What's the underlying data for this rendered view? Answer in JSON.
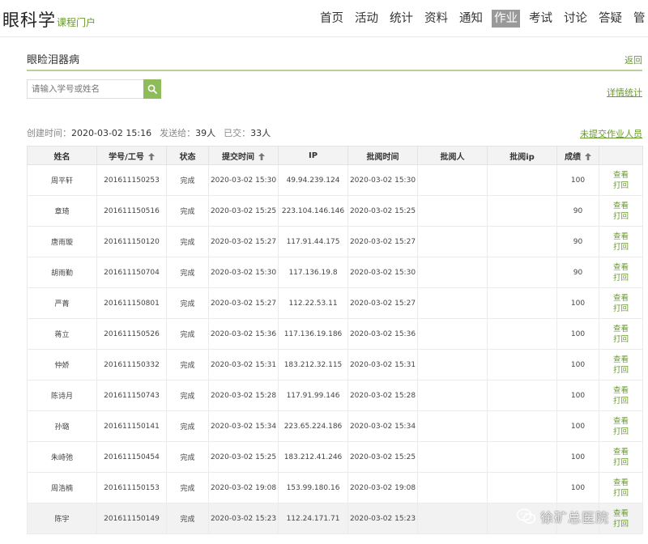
{
  "header": {
    "brand": "眼科学",
    "brand_sub": "课程门户",
    "nav": [
      "首页",
      "活动",
      "统计",
      "资料",
      "通知",
      "作业",
      "考试",
      "讨论",
      "答疑",
      "管"
    ],
    "active_nav": "作业"
  },
  "subheader": {
    "title": "眼睑泪器病",
    "back": "返回"
  },
  "search": {
    "placeholder": "请输入学号或姓名",
    "icon": "search-icon"
  },
  "links": {
    "detail_stats": "详情统计",
    "unsubmitted": "未提交作业人员"
  },
  "meta": {
    "created_label": "创建时间：",
    "created_value": "2020-03-02 15:16",
    "sent_label": "发送给：",
    "sent_value": "39人",
    "submitted_label": "已交：",
    "submitted_value": "33人"
  },
  "table": {
    "columns": [
      "姓名",
      "学号/工号",
      "状态",
      "提交时间",
      "IP",
      "批阅时间",
      "批阅人",
      "批阅ip",
      "成绩",
      ""
    ],
    "sortable": [
      false,
      true,
      false,
      true,
      false,
      false,
      false,
      false,
      true,
      false
    ],
    "op_view": "查看",
    "op_return": "打回",
    "rows": [
      {
        "name": "周平轩",
        "id": "201611150253",
        "status": "完成",
        "submit": "2020-03-02 15:30",
        "ip": "49.94.239.124",
        "review": "2020-03-02 15:30",
        "reviewer": "",
        "review_ip": "",
        "score": "100"
      },
      {
        "name": "章琦",
        "id": "201611150516",
        "status": "完成",
        "submit": "2020-03-02 15:25",
        "ip": "223.104.146.146",
        "review": "2020-03-02 15:25",
        "reviewer": "",
        "review_ip": "",
        "score": "90"
      },
      {
        "name": "唐雨璇",
        "id": "201611150120",
        "status": "完成",
        "submit": "2020-03-02 15:27",
        "ip": "117.91.44.175",
        "review": "2020-03-02 15:27",
        "reviewer": "",
        "review_ip": "",
        "score": "90"
      },
      {
        "name": "胡雨勤",
        "id": "201611150704",
        "status": "完成",
        "submit": "2020-03-02 15:30",
        "ip": "117.136.19.8",
        "review": "2020-03-02 15:30",
        "reviewer": "",
        "review_ip": "",
        "score": "90"
      },
      {
        "name": "严菁",
        "id": "201611150801",
        "status": "完成",
        "submit": "2020-03-02 15:27",
        "ip": "112.22.53.11",
        "review": "2020-03-02 15:27",
        "reviewer": "",
        "review_ip": "",
        "score": "100"
      },
      {
        "name": "蒋立",
        "id": "201611150526",
        "status": "完成",
        "submit": "2020-03-02 15:36",
        "ip": "117.136.19.186",
        "review": "2020-03-02 15:36",
        "reviewer": "",
        "review_ip": "",
        "score": "100"
      },
      {
        "name": "仲娇",
        "id": "201611150332",
        "status": "完成",
        "submit": "2020-03-02 15:31",
        "ip": "183.212.32.115",
        "review": "2020-03-02 15:31",
        "reviewer": "",
        "review_ip": "",
        "score": "100"
      },
      {
        "name": "陈诗月",
        "id": "201611150743",
        "status": "完成",
        "submit": "2020-03-02 15:28",
        "ip": "117.91.99.146",
        "review": "2020-03-02 15:28",
        "reviewer": "",
        "review_ip": "",
        "score": "100"
      },
      {
        "name": "孙璐",
        "id": "201611150141",
        "status": "完成",
        "submit": "2020-03-02 15:34",
        "ip": "223.65.224.186",
        "review": "2020-03-02 15:34",
        "reviewer": "",
        "review_ip": "",
        "score": "100"
      },
      {
        "name": "朱峙弛",
        "id": "201611150454",
        "status": "完成",
        "submit": "2020-03-02 15:25",
        "ip": "183.212.41.246",
        "review": "2020-03-02 15:25",
        "reviewer": "",
        "review_ip": "",
        "score": "100"
      },
      {
        "name": "周浩楠",
        "id": "201611150153",
        "status": "完成",
        "submit": "2020-03-02 19:08",
        "ip": "153.99.180.16",
        "review": "2020-03-02 19:08",
        "reviewer": "",
        "review_ip": "",
        "score": "100"
      },
      {
        "name": "陈宇",
        "id": "201611150149",
        "status": "完成",
        "submit": "2020-03-02 15:23",
        "ip": "112.24.171.71",
        "review": "2020-03-02 15:23",
        "reviewer": "",
        "review_ip": "",
        "score": ""
      }
    ],
    "highlight_row": 11
  },
  "watermark": {
    "text": "徐矿总医院",
    "icon": "wechat-icon"
  },
  "colors": {
    "accent": "#6a9a2d",
    "search_button": "#8fbc5a",
    "active_nav": "#999999"
  }
}
